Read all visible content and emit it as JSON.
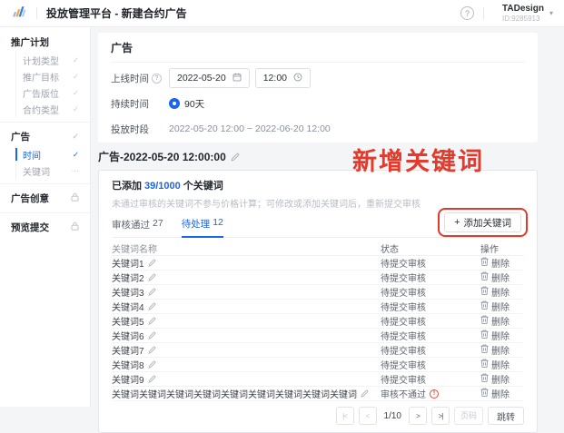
{
  "colors": {
    "accent": "#1A66E8",
    "annotation": "#E5392B",
    "error": "#E34D3C"
  },
  "icons": {
    "help_icon": "?",
    "info_icon": "?",
    "chevron_down_icon": "▾",
    "check_icon": "✓",
    "ellipsis_icon": "⋯",
    "plus_icon": "+",
    "warning_icon": "!",
    "first_page_icon": "|<",
    "prev_page_icon": "<",
    "next_page_icon": ">",
    "last_page_icon": ">|"
  },
  "header": {
    "title": "投放管理平台 - 新建合约广告",
    "account": {
      "name": "TADesign",
      "id": "ID:9285913"
    }
  },
  "sidebar": {
    "sections": [
      {
        "label": "推广计划",
        "children": [
          {
            "label": "计划类型",
            "state": "done"
          },
          {
            "label": "推广目标",
            "state": "done"
          },
          {
            "label": "广告版位",
            "state": "done"
          },
          {
            "label": "合约类型",
            "state": "done"
          }
        ]
      },
      {
        "label": "广告",
        "state": "done",
        "children": [
          {
            "label": "时间",
            "state": "active"
          },
          {
            "label": "关键词",
            "state": "pending"
          }
        ]
      },
      {
        "label": "广告创意",
        "state": "locked",
        "children": []
      },
      {
        "label": "预览提交",
        "state": "locked",
        "children": []
      }
    ]
  },
  "ad_section": {
    "title": "广告",
    "online_time_label": "上线时间",
    "date_value": "2022-05-20",
    "time_value": "12:00",
    "duration_label": "持续时间",
    "duration_value": "90天",
    "period_label": "投放时段",
    "period_value": "2022-05-20 12:00 ~ 2022-06-20 12:00"
  },
  "keyword_section": {
    "heading": "广告-2022-05-20 12:00:00",
    "added_prefix": "已添加",
    "added_count": "39/1000",
    "added_suffix": "个关键词",
    "hint": "未通过审核的关键词不参与价格计算；可修改或添加关键词后，重新提交审核",
    "tabs": [
      {
        "label": "审核通过",
        "count": "27",
        "active": false
      },
      {
        "label": "待处理",
        "count": "12",
        "active": true
      }
    ],
    "add_button_label": "添加关键词",
    "annotation": "新增关键词",
    "table": {
      "columns": [
        "关键词名称",
        "状态",
        "操作"
      ],
      "rows": [
        {
          "name": "关键词1",
          "status": "待提交审核",
          "error": false,
          "action": "删除"
        },
        {
          "name": "关键词2",
          "status": "待提交审核",
          "error": false,
          "action": "删除"
        },
        {
          "name": "关键词3",
          "status": "待提交审核",
          "error": false,
          "action": "删除"
        },
        {
          "name": "关键词4",
          "status": "待提交审核",
          "error": false,
          "action": "删除"
        },
        {
          "name": "关键词5",
          "status": "待提交审核",
          "error": false,
          "action": "删除"
        },
        {
          "name": "关键词6",
          "status": "待提交审核",
          "error": false,
          "action": "删除"
        },
        {
          "name": "关键词7",
          "status": "待提交审核",
          "error": false,
          "action": "删除"
        },
        {
          "name": "关键词8",
          "status": "待提交审核",
          "error": false,
          "action": "删除"
        },
        {
          "name": "关键词9",
          "status": "待提交审核",
          "error": false,
          "action": "删除"
        },
        {
          "name": "关键词关键词关键词关键词关键词关键词关键词关键词关键词",
          "status": "审核不通过",
          "error": true,
          "action": "删除"
        }
      ]
    },
    "pagination": {
      "current": "1/10",
      "input_placeholder": "页码",
      "jump_label": "跳转"
    }
  }
}
